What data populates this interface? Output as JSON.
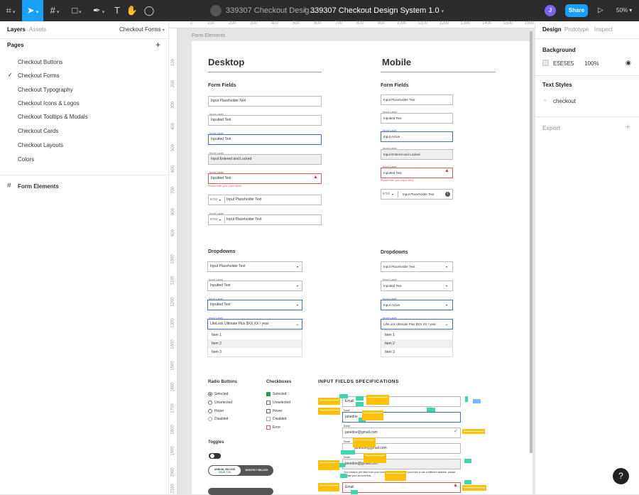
{
  "toolbar": {
    "tools": [
      "main-menu",
      "move",
      "frame",
      "shape",
      "pen",
      "text",
      "hand",
      "comment"
    ],
    "crumb": "339307 Checkout Desig...",
    "title": "339307 Checkout Design System 1.0",
    "avatar": "J",
    "share": "Share",
    "zoom": "50%"
  },
  "left": {
    "tabs": [
      "Layers",
      "Assets"
    ],
    "page_selector": "Checkout Forms",
    "pages_heading": "Pages",
    "pages": [
      "Checkout Buttons",
      "Checkout Forms",
      "Checkout Typography",
      "Checkout Icons & Logos",
      "Checkout Tooltips & Modals",
      "Checkout Cards",
      "Checkout Layouts",
      "Colors"
    ],
    "current_page_index": 1,
    "layer": "Form Elements"
  },
  "right": {
    "tabs": [
      "Design",
      "Prototype",
      "Inspect"
    ],
    "background_heading": "Background",
    "bg_hex": "E5E5E5",
    "bg_opacity": "100%",
    "text_styles_heading": "Text Styles",
    "text_style": "checkout",
    "export": "Export"
  },
  "rulers": {
    "top": [
      "0",
      "100",
      "200",
      "300",
      "400",
      "500",
      "600",
      "700",
      "800",
      "900",
      "1000",
      "1100",
      "1200",
      "1300",
      "1400",
      "1500",
      "1600"
    ],
    "left": [
      "100",
      "200",
      "300",
      "400",
      "500",
      "600",
      "700",
      "800",
      "900",
      "1000",
      "1100",
      "1200",
      "1300",
      "1400",
      "1500",
      "1600",
      "1700",
      "1800",
      "1900",
      "2000",
      "2100"
    ]
  },
  "canvas": {
    "frame_label": "Form Elements",
    "desktop": "Desktop",
    "mobile": "Mobile",
    "form_fields": "Form Fields",
    "dropdowns": "Dropdowns",
    "radio_buttons": "Radio Buttons",
    "checkboxes": "Checkboxes",
    "toggles": "Toggles",
    "spec_heading": "INPUT FIELDS SPECIFICATIONS",
    "label": "Input Label",
    "placeholder": "Input Placeholder Text",
    "inputted": "Inputted Text",
    "locked": "Input Entered and Locked",
    "active": "Input Active",
    "error_msg": "Please enter your (input label)",
    "code": "6703",
    "lifelock": "LifeLock Ultimate Plus $XX.XX / year",
    "items": [
      "Item 1",
      "Item 2",
      "Item 3"
    ],
    "radios": [
      "Selected",
      "Unselected",
      "Hover",
      "Disabled"
    ],
    "checks": [
      "Selected",
      "Unselected",
      "Hover",
      "Disabled",
      "Error"
    ],
    "seg_left": "ANNUAL BILLING",
    "seg_save": "SAVE 71%",
    "seg_right": "MONTHLY BILLING",
    "spec": {
      "email": "Email",
      "email_value": "janedoe@gmail.com",
      "jane_partial": "janedoe",
      "email_lbl": "Email",
      "hint": "Your email is pre-filled from your Norton account profile. If you'd like to use a different address, please update your account first."
    }
  }
}
